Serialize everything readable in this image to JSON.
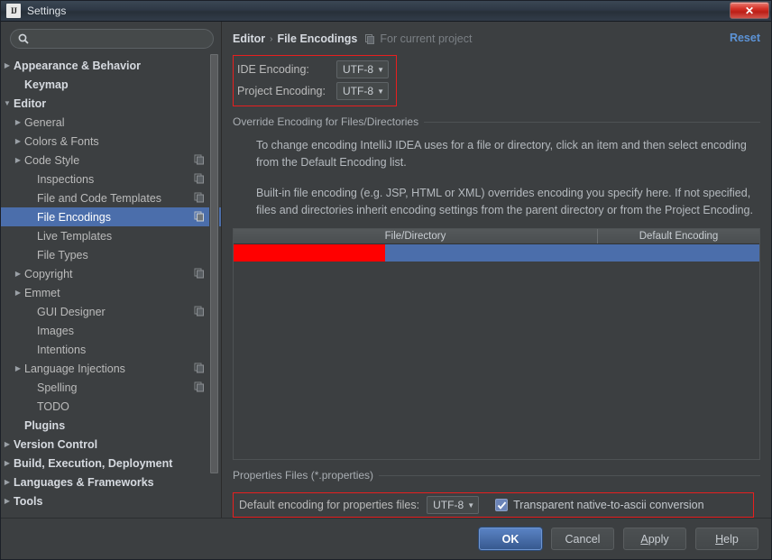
{
  "window": {
    "title": "Settings",
    "app_icon": "intellij-idea-icon",
    "close_label": "✕"
  },
  "search": {
    "placeholder": "",
    "value": "",
    "icon": "search-icon"
  },
  "sidebar": {
    "items": [
      {
        "label": "Appearance & Behavior",
        "arrow": "▶",
        "indent": 12,
        "bold": true,
        "selected": false,
        "icon": false
      },
      {
        "label": "Keymap",
        "arrow": "",
        "indent": 26,
        "bold": true,
        "selected": false,
        "icon": false
      },
      {
        "label": "Editor",
        "arrow": "▼",
        "indent": 12,
        "bold": true,
        "selected": false,
        "icon": false
      },
      {
        "label": "General",
        "arrow": "▶",
        "indent": 26,
        "bold": false,
        "selected": false,
        "icon": false
      },
      {
        "label": "Colors & Fonts",
        "arrow": "▶",
        "indent": 26,
        "bold": false,
        "selected": false,
        "icon": false
      },
      {
        "label": "Code Style",
        "arrow": "▶",
        "indent": 26,
        "bold": false,
        "selected": false,
        "icon": true
      },
      {
        "label": "Inspections",
        "arrow": "",
        "indent": 40,
        "bold": false,
        "selected": false,
        "icon": true
      },
      {
        "label": "File and Code Templates",
        "arrow": "",
        "indent": 40,
        "bold": false,
        "selected": false,
        "icon": true
      },
      {
        "label": "File Encodings",
        "arrow": "",
        "indent": 40,
        "bold": false,
        "selected": true,
        "icon": true
      },
      {
        "label": "Live Templates",
        "arrow": "",
        "indent": 40,
        "bold": false,
        "selected": false,
        "icon": false
      },
      {
        "label": "File Types",
        "arrow": "",
        "indent": 40,
        "bold": false,
        "selected": false,
        "icon": false
      },
      {
        "label": "Copyright",
        "arrow": "▶",
        "indent": 26,
        "bold": false,
        "selected": false,
        "icon": true
      },
      {
        "label": "Emmet",
        "arrow": "▶",
        "indent": 26,
        "bold": false,
        "selected": false,
        "icon": false
      },
      {
        "label": "GUI Designer",
        "arrow": "",
        "indent": 40,
        "bold": false,
        "selected": false,
        "icon": true
      },
      {
        "label": "Images",
        "arrow": "",
        "indent": 40,
        "bold": false,
        "selected": false,
        "icon": false
      },
      {
        "label": "Intentions",
        "arrow": "",
        "indent": 40,
        "bold": false,
        "selected": false,
        "icon": false
      },
      {
        "label": "Language Injections",
        "arrow": "▶",
        "indent": 26,
        "bold": false,
        "selected": false,
        "icon": true
      },
      {
        "label": "Spelling",
        "arrow": "",
        "indent": 40,
        "bold": false,
        "selected": false,
        "icon": true
      },
      {
        "label": "TODO",
        "arrow": "",
        "indent": 40,
        "bold": false,
        "selected": false,
        "icon": false
      },
      {
        "label": "Plugins",
        "arrow": "",
        "indent": 26,
        "bold": true,
        "selected": false,
        "icon": false
      },
      {
        "label": "Version Control",
        "arrow": "▶",
        "indent": 12,
        "bold": true,
        "selected": false,
        "icon": false
      },
      {
        "label": "Build, Execution, Deployment",
        "arrow": "▶",
        "indent": 12,
        "bold": true,
        "selected": false,
        "icon": false
      },
      {
        "label": "Languages & Frameworks",
        "arrow": "▶",
        "indent": 12,
        "bold": true,
        "selected": false,
        "icon": false
      },
      {
        "label": "Tools",
        "arrow": "▶",
        "indent": 12,
        "bold": true,
        "selected": false,
        "icon": false
      }
    ]
  },
  "header": {
    "crumb_parent": "Editor",
    "crumb_separator": "›",
    "crumb_current": "File Encodings",
    "scope_icon": "project-scope-icon",
    "scope_text": "For current project",
    "reset_label": "Reset"
  },
  "encoding": {
    "ide_label": "IDE Encoding:",
    "ide_value": "UTF-8",
    "project_label": "Project Encoding:",
    "project_value": "UTF-8",
    "caret": "▼"
  },
  "override": {
    "section_title": "Override Encoding for Files/Directories",
    "paragraph_1": "To change encoding IntelliJ IDEA uses for a file or directory, click an item and then select encoding from the Default Encoding list.",
    "paragraph_2": "Built-in file encoding (e.g. JSP, HTML or XML) overrides encoding you specify here. If not specified, files and directories inherit encoding settings from the parent directory or from the Project Encoding."
  },
  "table": {
    "columns": [
      "File/Directory",
      "Default Encoding"
    ],
    "rows": [
      {
        "file_directory": "",
        "default_encoding": "",
        "selected": true
      }
    ]
  },
  "properties": {
    "section_title": "Properties Files (*.properties)",
    "default_encoding_label": "Default encoding for properties files:",
    "default_encoding_value": "UTF-8",
    "transparent_label": "Transparent native-to-ascii conversion",
    "transparent_checked": true
  },
  "footer": {
    "ok": "OK",
    "cancel": "Cancel",
    "apply_prefix": "A",
    "apply_rest": "pply",
    "help_prefix": "H",
    "help_rest": "elp"
  },
  "colors": {
    "selection_blue": "#4b6eab",
    "annotation_red": "#e81f1f",
    "red_block": "#ff0000",
    "link_blue": "#5c93d6",
    "window_bg": "#3c3f41"
  }
}
